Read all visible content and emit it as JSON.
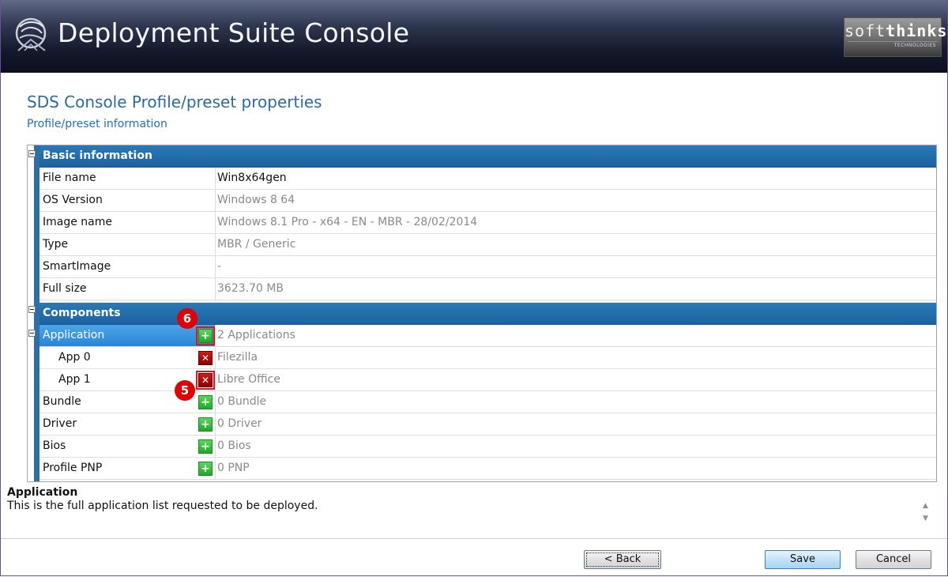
{
  "header": {
    "app_title": "Deployment Suite Console",
    "brand_logo": "softthinks",
    "brand_tagline": "TECHNOLOGIES"
  },
  "page": {
    "title": "SDS Console Profile/preset properties",
    "subtitle": "Profile/preset information"
  },
  "sections": {
    "basic": {
      "title": "Basic information",
      "rows": [
        {
          "label": "File name",
          "value": "Win8x64gen"
        },
        {
          "label": "OS Version",
          "value": "Windows 8 64"
        },
        {
          "label": "Image name",
          "value": "Windows 8.1 Pro - x64 - EN - MBR - 28/02/2014"
        },
        {
          "label": "Type",
          "value": "MBR / Generic"
        },
        {
          "label": "SmartImage",
          "value": "-"
        },
        {
          "label": "Full size",
          "value": "3623.70 MB"
        }
      ]
    },
    "components": {
      "title": "Components",
      "application": {
        "label": "Application",
        "value": "2 Applications"
      },
      "apps": [
        {
          "label": "App 0",
          "value": "Filezilla"
        },
        {
          "label": "App 1",
          "value": "Libre Office"
        }
      ],
      "others": [
        {
          "label": "Bundle",
          "value": "0 Bundle"
        },
        {
          "label": "Driver",
          "value": "0 Driver"
        },
        {
          "label": "Bios",
          "value": "0 Bios"
        },
        {
          "label": "Profile PNP",
          "value": "0 PNP"
        }
      ]
    }
  },
  "annotations": {
    "badge_add": "6",
    "badge_remove": "5"
  },
  "icons": {
    "add": "plus-icon",
    "remove": "x-icon",
    "collapse": "minus-box-icon"
  },
  "glyphs": {
    "plus": "+",
    "x": "✕",
    "scroll_up": "▲",
    "scroll_down": "▼"
  },
  "description": {
    "title": "Application",
    "text": "This is the full application list requested to be deployed."
  },
  "buttons": {
    "back": "< Back",
    "save": "Save",
    "cancel": "Cancel"
  },
  "colors": {
    "section_header": "#1d62a0",
    "selected_row": "#3399e6",
    "add_button": "#2fb53a",
    "remove_button": "#b00000",
    "badge": "#e00000"
  }
}
